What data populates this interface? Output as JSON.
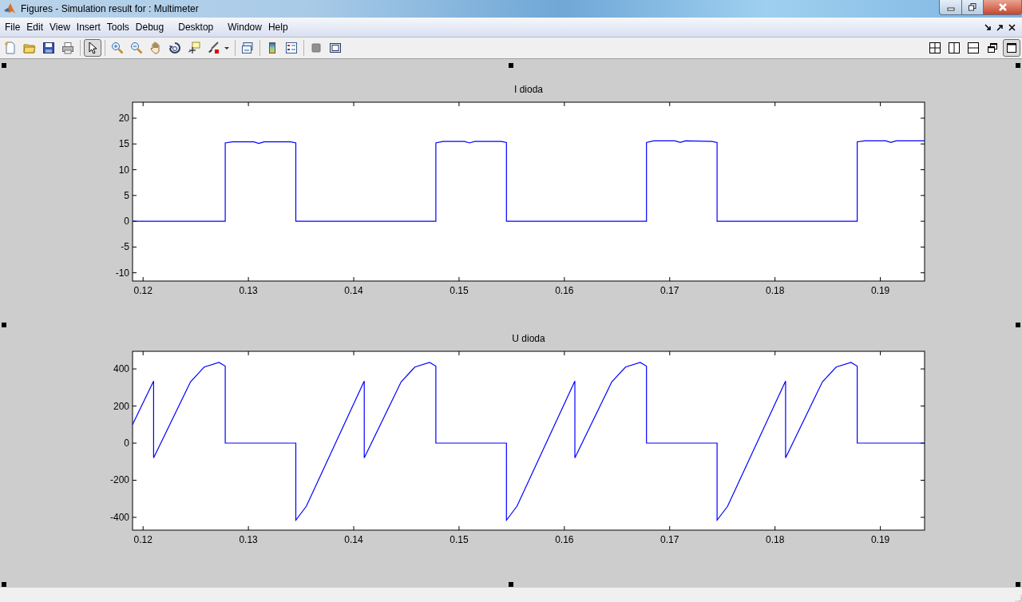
{
  "window": {
    "title": "Figures - Simulation result for : Multimeter"
  },
  "menu": [
    "File",
    "Edit",
    "View",
    "Insert",
    "Tools",
    "Debug",
    "Desktop",
    "Window",
    "Help"
  ],
  "toolbar": {
    "left": [
      {
        "kind": "new",
        "selected": false
      },
      {
        "kind": "open",
        "selected": false
      },
      {
        "kind": "save",
        "selected": false
      },
      {
        "kind": "print",
        "selected": false
      },
      {
        "kind": "sep"
      },
      {
        "kind": "pointer",
        "selected": true
      },
      {
        "kind": "sep"
      },
      {
        "kind": "zoomin",
        "selected": false
      },
      {
        "kind": "zoomout",
        "selected": false
      },
      {
        "kind": "pan",
        "selected": false
      },
      {
        "kind": "rotate",
        "selected": false
      },
      {
        "kind": "cursor",
        "selected": false
      },
      {
        "kind": "brush",
        "selected": false
      },
      {
        "kind": "caret"
      },
      {
        "kind": "sep"
      },
      {
        "kind": "link",
        "selected": false
      },
      {
        "kind": "sep"
      },
      {
        "kind": "colorbar",
        "selected": false
      },
      {
        "kind": "legend",
        "selected": false
      },
      {
        "kind": "sep"
      },
      {
        "kind": "hide",
        "selected": false
      },
      {
        "kind": "show",
        "selected": false
      }
    ],
    "right": [
      {
        "kind": "grid4",
        "selected": false
      },
      {
        "kind": "cols",
        "selected": false
      },
      {
        "kind": "rows",
        "selected": false
      },
      {
        "kind": "float",
        "selected": false
      },
      {
        "kind": "max",
        "selected": true
      }
    ]
  },
  "axes": [
    {
      "chart_data": {
        "type": "line",
        "title": "I dioda",
        "x": [
          0.119,
          0.1278,
          0.1278,
          0.1285,
          0.1305,
          0.131,
          0.1315,
          0.134,
          0.1345,
          0.1345,
          0.1478,
          0.1478,
          0.1485,
          0.1505,
          0.151,
          0.1515,
          0.154,
          0.1545,
          0.1545,
          0.1678,
          0.1678,
          0.1685,
          0.1705,
          0.171,
          0.1715,
          0.174,
          0.1745,
          0.1745,
          0.1878,
          0.1878,
          0.1885,
          0.1905,
          0.191,
          0.1915,
          0.1942
        ],
        "series": [
          {
            "color": "#0000ff",
            "values": [
              0,
              0,
              15.2,
              15.4,
              15.4,
              15.1,
              15.4,
              15.4,
              15.2,
              0,
              0,
              15.2,
              15.5,
              15.5,
              15.2,
              15.5,
              15.5,
              15.3,
              0,
              0,
              15.3,
              15.6,
              15.6,
              15.3,
              15.6,
              15.5,
              15.3,
              0,
              0,
              15.4,
              15.6,
              15.6,
              15.3,
              15.6,
              15.6
            ]
          }
        ],
        "xlim": [
          0.119,
          0.1942
        ],
        "ylim": [
          -11.6,
          23.1
        ],
        "xticks": [
          {
            "value": 0.12,
            "label": "0.12"
          },
          {
            "value": 0.13,
            "label": "0.13"
          },
          {
            "value": 0.14,
            "label": "0.14"
          },
          {
            "value": 0.15,
            "label": "0.15"
          },
          {
            "value": 0.16,
            "label": "0.16"
          },
          {
            "value": 0.17,
            "label": "0.17"
          },
          {
            "value": 0.18,
            "label": "0.18"
          },
          {
            "value": 0.19,
            "label": "0.19"
          }
        ],
        "yticks": [
          {
            "value": -10,
            "label": "-10"
          },
          {
            "value": -5,
            "label": "-5"
          },
          {
            "value": 0,
            "label": "0"
          },
          {
            "value": 5,
            "label": "5"
          },
          {
            "value": 10,
            "label": "10"
          },
          {
            "value": 15,
            "label": "15"
          },
          {
            "value": 20,
            "label": "20"
          }
        ]
      }
    },
    {
      "chart_data": {
        "type": "line",
        "title": "U dioda",
        "x": [
          0.119,
          0.121,
          0.121,
          0.1245,
          0.1258,
          0.1272,
          0.1278,
          0.1278,
          0.1345,
          0.1345,
          0.1355,
          0.141,
          0.141,
          0.1445,
          0.1458,
          0.1472,
          0.1478,
          0.1478,
          0.1545,
          0.1545,
          0.1555,
          0.161,
          0.161,
          0.1645,
          0.1658,
          0.1672,
          0.1678,
          0.1678,
          0.1745,
          0.1745,
          0.1755,
          0.181,
          0.181,
          0.1845,
          0.1858,
          0.1872,
          0.1878,
          0.1878,
          0.1942
        ],
        "series": [
          {
            "color": "#0000ff",
            "values": [
              100,
              335,
              -80,
              330,
              410,
              435,
              415,
              0,
              0,
              -415,
              -340,
              335,
              -80,
              330,
              410,
              435,
              415,
              0,
              0,
              -415,
              -340,
              335,
              -80,
              330,
              410,
              435,
              415,
              0,
              0,
              -415,
              -340,
              335,
              -80,
              330,
              410,
              435,
              415,
              0,
              0
            ]
          }
        ],
        "xlim": [
          0.119,
          0.1942
        ],
        "ylim": [
          -469,
          495
        ],
        "xticks": [
          {
            "value": 0.12,
            "label": "0.12"
          },
          {
            "value": 0.13,
            "label": "0.13"
          },
          {
            "value": 0.14,
            "label": "0.14"
          },
          {
            "value": 0.15,
            "label": "0.15"
          },
          {
            "value": 0.16,
            "label": "0.16"
          },
          {
            "value": 0.17,
            "label": "0.17"
          },
          {
            "value": 0.18,
            "label": "0.18"
          },
          {
            "value": 0.19,
            "label": "0.19"
          }
        ],
        "yticks": [
          {
            "value": -400,
            "label": "-400"
          },
          {
            "value": -200,
            "label": "-200"
          },
          {
            "value": 0,
            "label": "0"
          },
          {
            "value": 200,
            "label": "200"
          },
          {
            "value": 400,
            "label": "400"
          }
        ]
      }
    }
  ]
}
